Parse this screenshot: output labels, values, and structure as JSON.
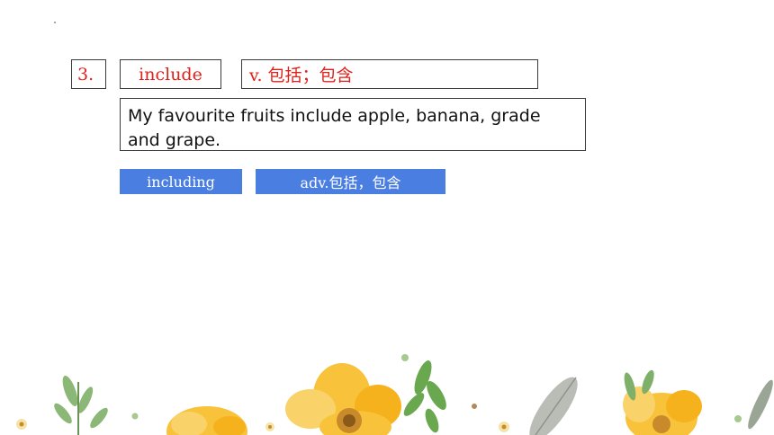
{
  "slide": {
    "number": "3.",
    "word": "include",
    "meaning": "v. 包括；包含",
    "example": "My favourite fruits include apple, banana, grade and grape.",
    "derivatives": [
      {
        "label": "including"
      },
      {
        "label": "adv.包括，包含"
      }
    ]
  },
  "colors": {
    "red_text": "#e0201a",
    "blue_button": "#4a7ee0",
    "flower_yellow": "#f7b928",
    "leaf_green": "#6aa84f"
  }
}
